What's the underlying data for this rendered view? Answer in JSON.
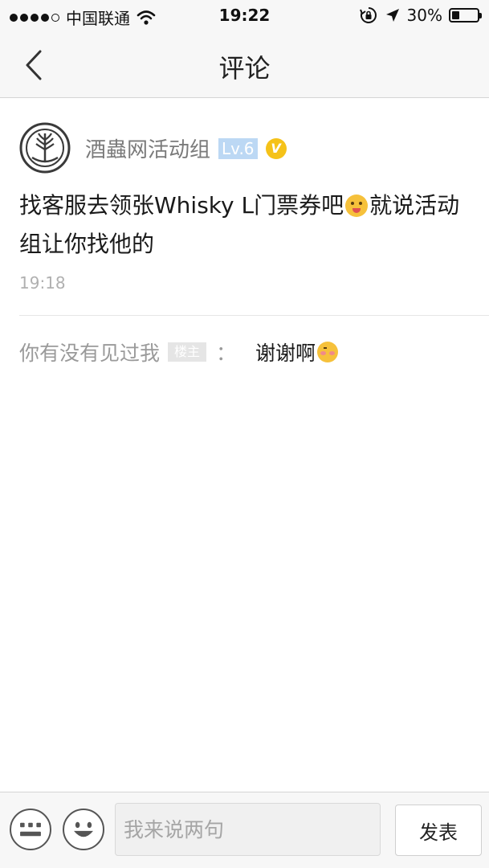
{
  "status_bar": {
    "carrier": "中国联通",
    "time": "19:22",
    "battery": "30%",
    "battery_level": 0.3,
    "icons": [
      "signal-dots-icon",
      "wifi-icon",
      "rotation-lock-icon",
      "location-arrow-icon",
      "battery-icon"
    ]
  },
  "nav": {
    "title": "评论",
    "back_icon": "chevron-left-icon"
  },
  "comment": {
    "username": "酒蟲网活动组",
    "level": "Lv.6",
    "verified_mark": "V",
    "text_part1": "找客服去领张Whisky L门票券吧",
    "text_part2": "就说活动组让你找他的",
    "emoji": "crazy-face-emoji",
    "time": "19:18"
  },
  "reply": {
    "user": "你有没有见过我",
    "owner_badge": "楼主",
    "colon": "：",
    "text": "谢谢啊",
    "emoji": "shy-face-emoji"
  },
  "input_bar": {
    "placeholder": "我来说两句",
    "send_label": "发表",
    "keyboard_icon": "keyboard-icon",
    "emoji_icon": "emoji-icon"
  },
  "colors": {
    "level_badge": "#bcd8f4",
    "verified_badge": "#f5c219",
    "owner_badge": "#e5e5e5"
  }
}
